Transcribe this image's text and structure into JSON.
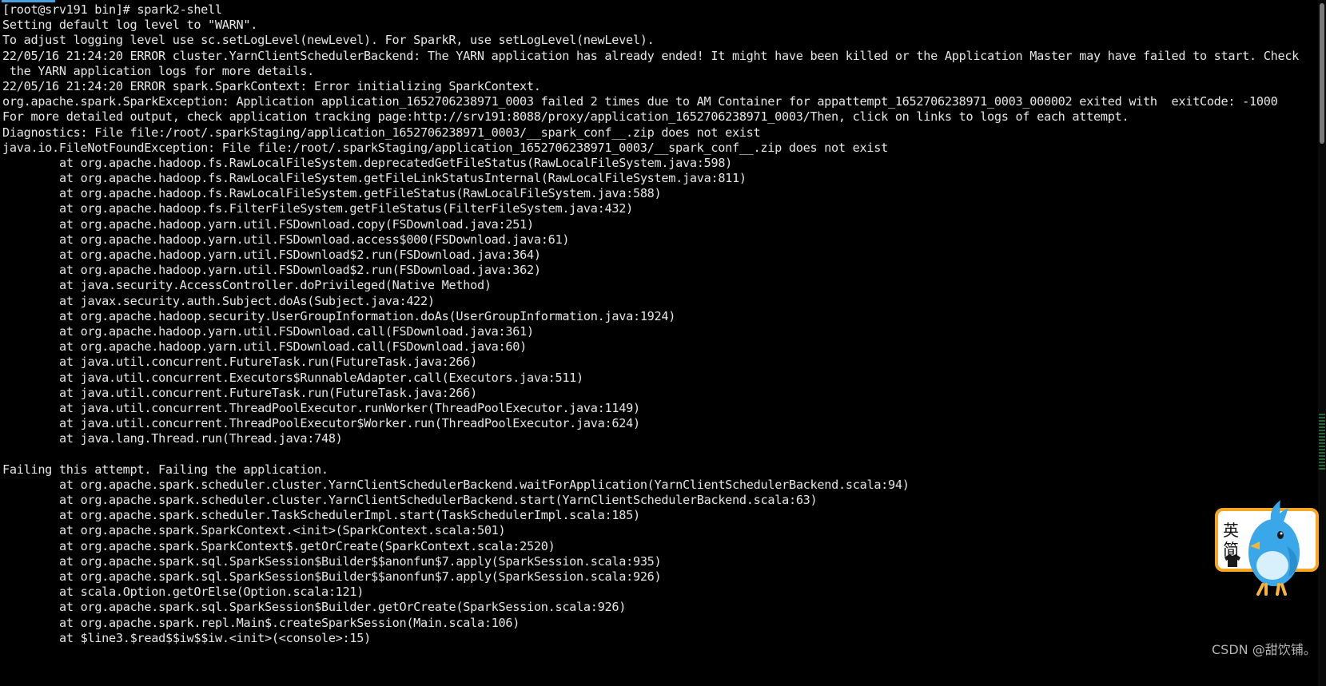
{
  "terminal": {
    "lines": [
      {
        "text": "[root@srv191 bin]# spark2-shell",
        "indent": false
      },
      {
        "text": "Setting default log level to \"WARN\".",
        "indent": false
      },
      {
        "text": "To adjust logging level use sc.setLogLevel(newLevel). For SparkR, use setLogLevel(newLevel).",
        "indent": false
      },
      {
        "text": "22/05/16 21:24:20 ERROR cluster.YarnClientSchedulerBackend: The YARN application has already ended! It might have been killed or the Application Master may have failed to start. Check",
        "indent": false
      },
      {
        "text": " the YARN application logs for more details.",
        "indent": false
      },
      {
        "text": "22/05/16 21:24:20 ERROR spark.SparkContext: Error initializing SparkContext.",
        "indent": false
      },
      {
        "text": "org.apache.spark.SparkException: Application application_1652706238971_0003 failed 2 times due to AM Container for appattempt_1652706238971_0003_000002 exited with  exitCode: -1000",
        "indent": false
      },
      {
        "text": "For more detailed output, check application tracking page:http://srv191:8088/proxy/application_1652706238971_0003/Then, click on links to logs of each attempt.",
        "indent": false
      },
      {
        "text": "Diagnostics: File file:/root/.sparkStaging/application_1652706238971_0003/__spark_conf__.zip does not exist",
        "indent": false
      },
      {
        "text": "java.io.FileNotFoundException: File file:/root/.sparkStaging/application_1652706238971_0003/__spark_conf__.zip does not exist",
        "indent": false
      },
      {
        "text": "at org.apache.hadoop.fs.RawLocalFileSystem.deprecatedGetFileStatus(RawLocalFileSystem.java:598)",
        "indent": true
      },
      {
        "text": "at org.apache.hadoop.fs.RawLocalFileSystem.getFileLinkStatusInternal(RawLocalFileSystem.java:811)",
        "indent": true
      },
      {
        "text": "at org.apache.hadoop.fs.RawLocalFileSystem.getFileStatus(RawLocalFileSystem.java:588)",
        "indent": true
      },
      {
        "text": "at org.apache.hadoop.fs.FilterFileSystem.getFileStatus(FilterFileSystem.java:432)",
        "indent": true
      },
      {
        "text": "at org.apache.hadoop.yarn.util.FSDownload.copy(FSDownload.java:251)",
        "indent": true
      },
      {
        "text": "at org.apache.hadoop.yarn.util.FSDownload.access$000(FSDownload.java:61)",
        "indent": true
      },
      {
        "text": "at org.apache.hadoop.yarn.util.FSDownload$2.run(FSDownload.java:364)",
        "indent": true
      },
      {
        "text": "at org.apache.hadoop.yarn.util.FSDownload$2.run(FSDownload.java:362)",
        "indent": true
      },
      {
        "text": "at java.security.AccessController.doPrivileged(Native Method)",
        "indent": true
      },
      {
        "text": "at javax.security.auth.Subject.doAs(Subject.java:422)",
        "indent": true
      },
      {
        "text": "at org.apache.hadoop.security.UserGroupInformation.doAs(UserGroupInformation.java:1924)",
        "indent": true
      },
      {
        "text": "at org.apache.hadoop.yarn.util.FSDownload.call(FSDownload.java:361)",
        "indent": true
      },
      {
        "text": "at org.apache.hadoop.yarn.util.FSDownload.call(FSDownload.java:60)",
        "indent": true
      },
      {
        "text": "at java.util.concurrent.FutureTask.run(FutureTask.java:266)",
        "indent": true
      },
      {
        "text": "at java.util.concurrent.Executors$RunnableAdapter.call(Executors.java:511)",
        "indent": true
      },
      {
        "text": "at java.util.concurrent.FutureTask.run(FutureTask.java:266)",
        "indent": true
      },
      {
        "text": "at java.util.concurrent.ThreadPoolExecutor.runWorker(ThreadPoolExecutor.java:1149)",
        "indent": true
      },
      {
        "text": "at java.util.concurrent.ThreadPoolExecutor$Worker.run(ThreadPoolExecutor.java:624)",
        "indent": true
      },
      {
        "text": "at java.lang.Thread.run(Thread.java:748)",
        "indent": true
      },
      {
        "text": "",
        "indent": false
      },
      {
        "text": "Failing this attempt. Failing the application.",
        "indent": false
      },
      {
        "text": "at org.apache.spark.scheduler.cluster.YarnClientSchedulerBackend.waitForApplication(YarnClientSchedulerBackend.scala:94)",
        "indent": true
      },
      {
        "text": "at org.apache.spark.scheduler.cluster.YarnClientSchedulerBackend.start(YarnClientSchedulerBackend.scala:63)",
        "indent": true
      },
      {
        "text": "at org.apache.spark.scheduler.TaskSchedulerImpl.start(TaskSchedulerImpl.scala:185)",
        "indent": true
      },
      {
        "text": "at org.apache.spark.SparkContext.<init>(SparkContext.scala:501)",
        "indent": true
      },
      {
        "text": "at org.apache.spark.SparkContext$.getOrCreate(SparkContext.scala:2520)",
        "indent": true
      },
      {
        "text": "at org.apache.spark.sql.SparkSession$Builder$$anonfun$7.apply(SparkSession.scala:935)",
        "indent": true
      },
      {
        "text": "at org.apache.spark.sql.SparkSession$Builder$$anonfun$7.apply(SparkSession.scala:926)",
        "indent": true
      },
      {
        "text": "at scala.Option.getOrElse(Option.scala:121)",
        "indent": true
      },
      {
        "text": "at org.apache.spark.sql.SparkSession$Builder.getOrCreate(SparkSession.scala:926)",
        "indent": true
      },
      {
        "text": "at org.apache.spark.repl.Main$.createSparkSession(Main.scala:106)",
        "indent": true
      },
      {
        "text": "at $line3.$read$$iw$$iw.<init>(<console>:15)",
        "indent": true
      }
    ]
  },
  "sticker": {
    "chars": [
      "英",
      "简"
    ]
  },
  "watermark": {
    "text": "CSDN @甜饮铺。"
  },
  "colors": {
    "background": "#000000",
    "text": "#e6e6e6",
    "accent": "#4a9fe0",
    "sticker_border": "#f5a623",
    "bird": "#3aa7e8"
  }
}
